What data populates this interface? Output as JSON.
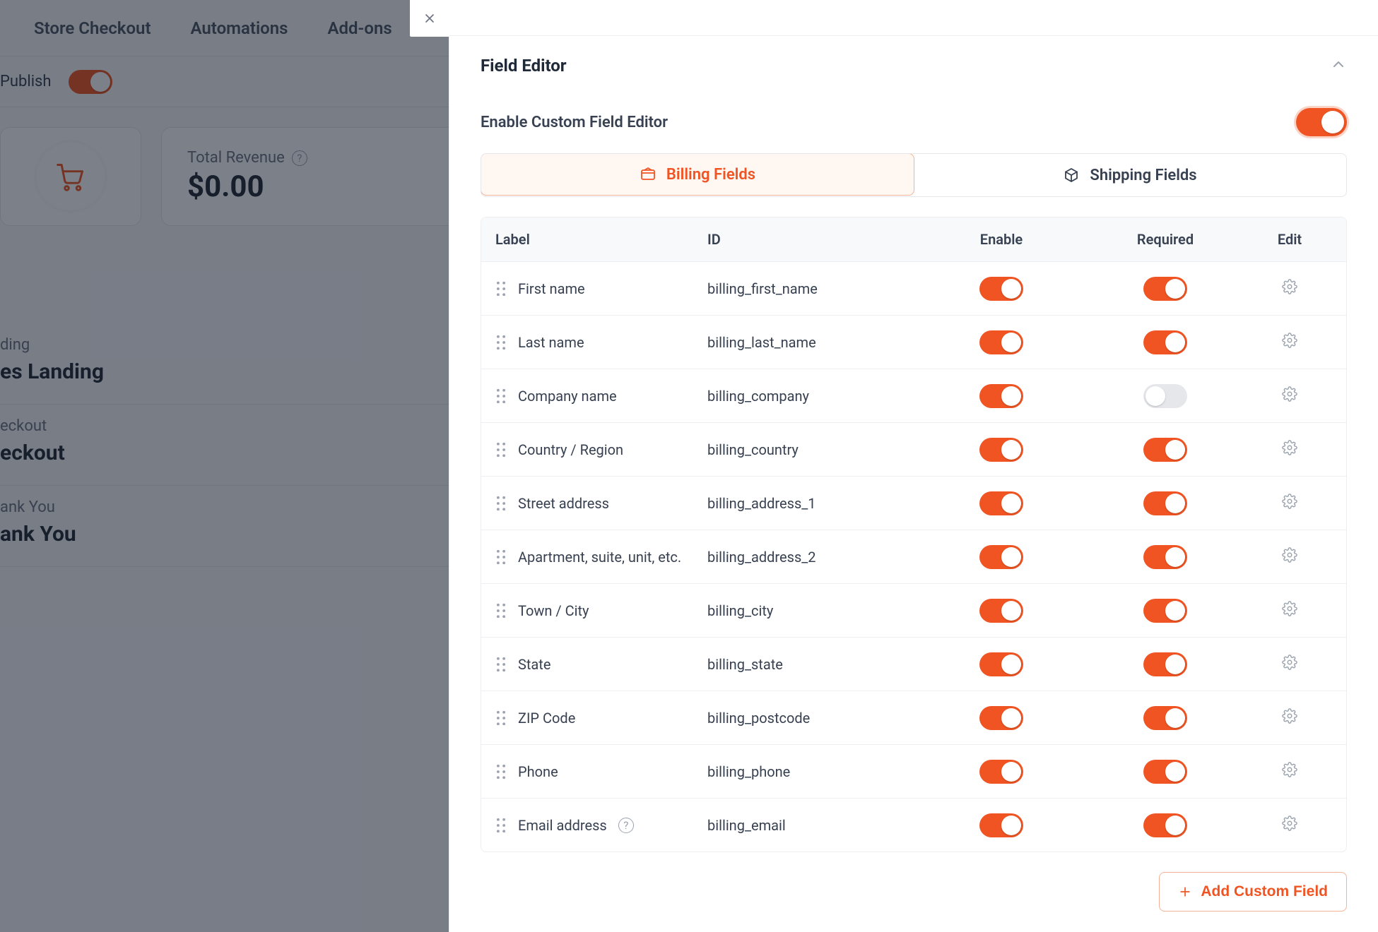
{
  "colors": {
    "accent": "#f05423"
  },
  "background": {
    "nav": [
      "Store Checkout",
      "Automations",
      "Add-ons"
    ],
    "publish_label": "Publish",
    "publish_on": true,
    "revenue_label": "Total Revenue",
    "revenue_value": "$0.00",
    "steps": [
      {
        "eyebrow": "ding",
        "title": "es Landing"
      },
      {
        "eyebrow": "eckout",
        "title": "eckout"
      },
      {
        "eyebrow": "ank You",
        "title": "ank You"
      }
    ]
  },
  "panel": {
    "title": "Field Editor",
    "enable_label": "Enable Custom Field Editor",
    "enable_on": true,
    "tabs": {
      "billing": "Billing Fields",
      "shipping": "Shipping Fields",
      "active": "billing"
    },
    "columns": {
      "label": "Label",
      "id": "ID",
      "enable": "Enable",
      "required": "Required",
      "edit": "Edit"
    },
    "rows": [
      {
        "label": "First name",
        "id": "billing_first_name",
        "enable": true,
        "required": true,
        "help": false
      },
      {
        "label": "Last name",
        "id": "billing_last_name",
        "enable": true,
        "required": true,
        "help": false
      },
      {
        "label": "Company name",
        "id": "billing_company",
        "enable": true,
        "required": false,
        "help": false
      },
      {
        "label": "Country / Region",
        "id": "billing_country",
        "enable": true,
        "required": true,
        "help": false
      },
      {
        "label": "Street address",
        "id": "billing_address_1",
        "enable": true,
        "required": true,
        "help": false
      },
      {
        "label": "Apartment, suite, unit, etc.",
        "id": "billing_address_2",
        "enable": true,
        "required": true,
        "help": false
      },
      {
        "label": "Town / City",
        "id": "billing_city",
        "enable": true,
        "required": true,
        "help": false
      },
      {
        "label": "State",
        "id": "billing_state",
        "enable": true,
        "required": true,
        "help": false
      },
      {
        "label": "ZIP Code",
        "id": "billing_postcode",
        "enable": true,
        "required": true,
        "help": false
      },
      {
        "label": "Phone",
        "id": "billing_phone",
        "enable": true,
        "required": true,
        "help": false
      },
      {
        "label": "Email address",
        "id": "billing_email",
        "enable": true,
        "required": true,
        "help": true
      }
    ],
    "add_button": "Add Custom Field"
  }
}
